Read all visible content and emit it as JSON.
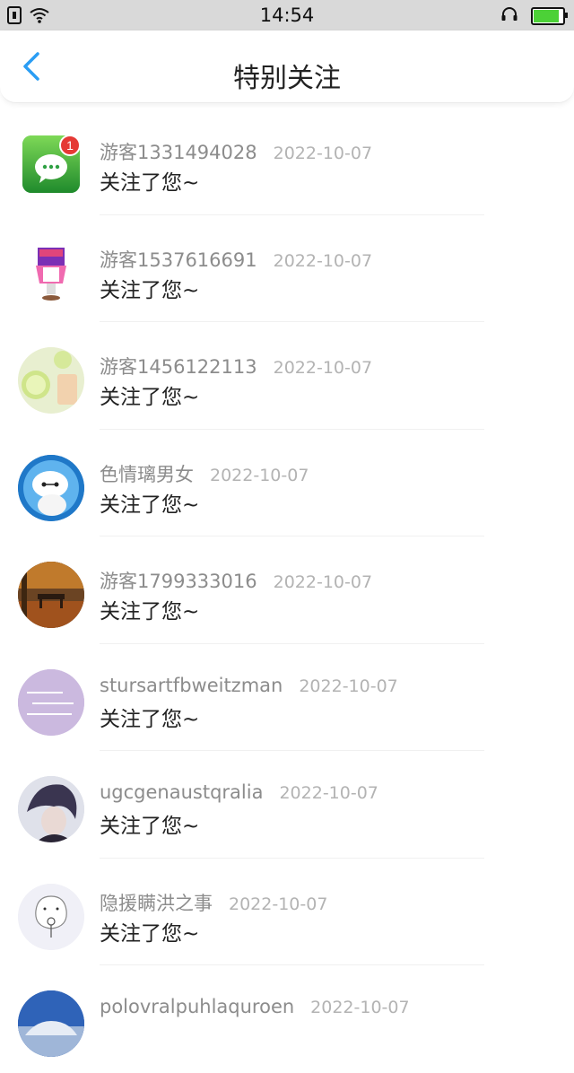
{
  "statusbar": {
    "time": "14:54"
  },
  "header": {
    "title": "特别关注"
  },
  "items": [
    {
      "name": "游客1331494028",
      "date": "2022-10-07",
      "message": "关注了您~",
      "badge": "1"
    },
    {
      "name": "游客1537616691",
      "date": "2022-10-07",
      "message": "关注了您~"
    },
    {
      "name": "游客1456122113",
      "date": "2022-10-07",
      "message": "关注了您~"
    },
    {
      "name": "色情璃男女",
      "date": "2022-10-07",
      "message": "关注了您~"
    },
    {
      "name": "游客1799333016",
      "date": "2022-10-07",
      "message": "关注了您~"
    },
    {
      "name": "stursartfbweitzman",
      "date": "2022-10-07",
      "message": "关注了您~"
    },
    {
      "name": "ugcgenaustqralia",
      "date": "2022-10-07",
      "message": "关注了您~"
    },
    {
      "name": "隐援瞒洪之事",
      "date": "2022-10-07",
      "message": "关注了您~"
    },
    {
      "name": "polovralpuhlaquroen",
      "date": "2022-10-07",
      "message": ""
    }
  ]
}
